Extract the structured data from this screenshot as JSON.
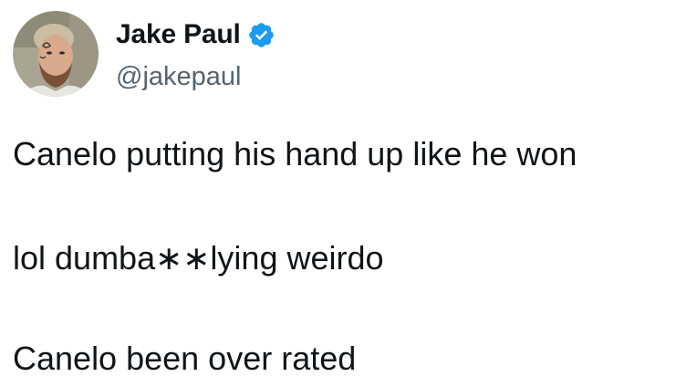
{
  "author": {
    "display_name": "Jake Paul",
    "handle": "@jakepaul",
    "verified": true,
    "verified_color": "#1d9bf0",
    "avatar_icon": "profile-photo"
  },
  "tweet": {
    "lines": [
      "Canelo putting his hand up like he won",
      "lol dumba∗∗lying weirdo",
      "Canelo been over rated"
    ]
  },
  "colors": {
    "text_primary": "#0f1419",
    "text_secondary": "#536471",
    "background": "#ffffff"
  }
}
